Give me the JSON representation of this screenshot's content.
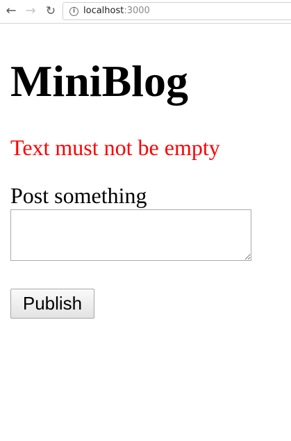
{
  "browser": {
    "url_host": "localhost",
    "url_port": ":3000",
    "info_icon_glyph": "i",
    "back_icon": "arrow-left-icon",
    "forward_icon": "arrow-right-icon",
    "reload_icon": "reload-icon"
  },
  "page": {
    "title": "MiniBlog",
    "error": "Text must not be empty",
    "form": {
      "label": "Post something",
      "text_value": "",
      "submit_label": "Publish"
    }
  },
  "colors": {
    "error": "#ff0000"
  }
}
